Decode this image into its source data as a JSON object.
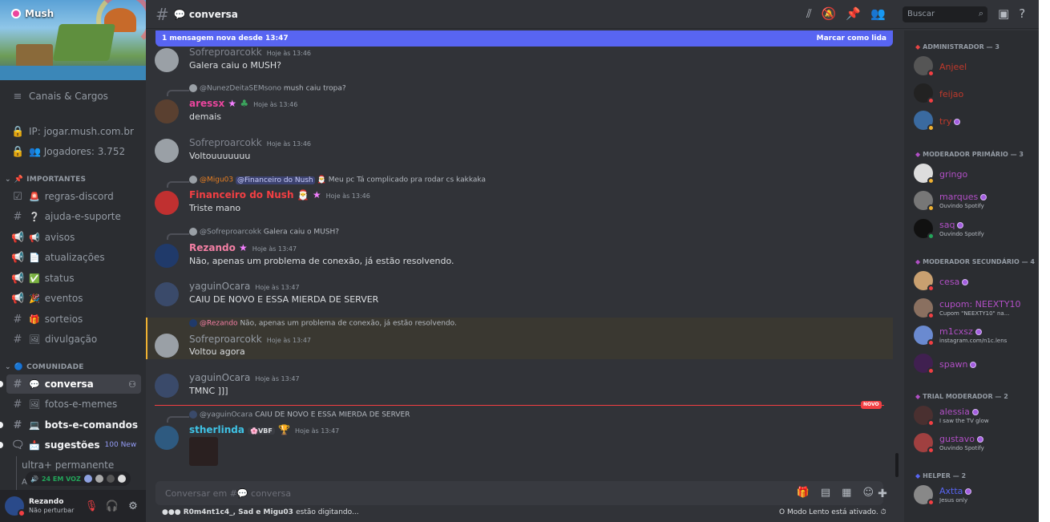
{
  "server": {
    "name": "Mush",
    "items": [
      {
        "label": "Canais & Cargos",
        "icon": "list-icon"
      },
      {
        "label": "IP: jogar.mush.com.br",
        "icon": "lock-icon"
      },
      {
        "label": "👥 Jogadores: 3.752",
        "icon": "lock-icon"
      }
    ],
    "categories": [
      {
        "label": "IMPORTANTES",
        "emoji": "📌"
      },
      {
        "label": "COMUNIDADE",
        "emoji": "🔵"
      }
    ],
    "channels": [
      {
        "label": "regras-discord",
        "emoji": "🚨",
        "icon": "rules-icon"
      },
      {
        "label": "ajuda-e-suporte",
        "emoji": "❔",
        "icon": "hash-icon"
      },
      {
        "label": "avisos",
        "emoji": "📢",
        "icon": "megaphone-icon"
      },
      {
        "label": "atualizações",
        "emoji": "📄",
        "icon": "megaphone-icon"
      },
      {
        "label": "status",
        "emoji": "✅",
        "icon": "megaphone-icon"
      },
      {
        "label": "eventos",
        "emoji": "🎉",
        "icon": "megaphone-icon"
      },
      {
        "label": "sorteios",
        "emoji": "🎁",
        "icon": "hash-icon"
      },
      {
        "label": "divulgação",
        "emoji": "🖼",
        "icon": "hash-icon"
      },
      {
        "label": "conversa",
        "emoji": "💬",
        "icon": "hash-icon"
      },
      {
        "label": "fotos-e-memes",
        "emoji": "🖼",
        "icon": "hash-icon"
      },
      {
        "label": "bots-e-comandos",
        "emoji": "💻",
        "icon": "hash-icon"
      },
      {
        "label": "sugestões",
        "emoji": "📩",
        "icon": "forum-icon",
        "badge": "100 New"
      },
      {
        "label": "ultra+ permanente"
      },
      {
        "label": "Auto-click"
      }
    ],
    "voice_pill": "24 EM VOZ"
  },
  "user": {
    "name": "Rezando",
    "status": "Não perturbar"
  },
  "header": {
    "channel": "💬 conversa",
    "search_placeholder": "Buscar"
  },
  "newbar": {
    "text": "1 mensagem nova desde 13:47",
    "action": "Marcar como lida"
  },
  "messages": [
    {
      "user": "Sofreproarcokk",
      "time": "Hoje às 13:46",
      "text": "Galera caiu o MUSH?"
    },
    {
      "reply_user": "@NunezDeitaSEMsono",
      "reply_text": "mush caiu tropa?",
      "user": "aressx",
      "time": "Hoje às 13:46",
      "text": "demais"
    },
    {
      "user": "Sofreproarcokk",
      "time": "Hoje às 13:46",
      "text": "Voltouuuuuuu"
    },
    {
      "reply_user": "@Migu03",
      "reply_mention": "@Financeiro do Nush",
      "reply_text": "Meu pc Tá complicado pra rodar cs kakkaka",
      "user": "Financeiro do Nush",
      "time": "Hoje às 13:46",
      "text": "Triste mano"
    },
    {
      "reply_user": "@Sofreproarcokk",
      "reply_text": "Galera caiu o MUSH?",
      "user": "Rezando",
      "time": "Hoje às 13:47",
      "text": "Não, apenas um problema de conexão, já estão resolvendo."
    },
    {
      "user": "yaguinOcara",
      "time": "Hoje às 13:47",
      "text": "CAIU DE NOVO E ESSA MIERDA DE SERVER"
    },
    {
      "reply_user": "@Rezando",
      "reply_text": "Não, apenas um problema de conexão, já estão resolvendo.",
      "user": "Sofreproarcokk",
      "time": "Hoje às 13:47",
      "text": "Voltou agora"
    },
    {
      "user": "yaguinOcara",
      "time": "Hoje às 13:47",
      "text": "TMNC ]]]"
    },
    {
      "reply_user": "@yaguinOcara",
      "reply_text": "CAIU DE NOVO E ESSA MIERDA DE SERVER",
      "user": "stherlinda",
      "tag": "VBF",
      "time": "Hoje às 13:47",
      "text": ""
    }
  ],
  "new_tag": "NOVO",
  "composer": {
    "placeholder": "Conversar em #💬 conversa"
  },
  "typing": {
    "names": "R0m4nt1c4_, Sad e Migu03",
    "suffix": "estão digitando..."
  },
  "slowmode": "O Modo Lento está ativado.",
  "member_groups": [
    {
      "label": "ADMINISTRADOR — 3",
      "members": [
        {
          "name": "Anjeel",
          "color": "#c0392b",
          "sub": ""
        },
        {
          "name": "feijao",
          "color": "#c0392b",
          "sub": ""
        },
        {
          "name": "try",
          "color": "#c0392b",
          "sub": ""
        }
      ]
    },
    {
      "label": "MODERADOR PRIMÁRIO — 3",
      "members": [
        {
          "name": "gringo",
          "color": "#b14fc5",
          "sub": ""
        },
        {
          "name": "marques",
          "color": "#b14fc5",
          "sub": "Ouvindo Spotify"
        },
        {
          "name": "saq",
          "color": "#b14fc5",
          "sub": "Ouvindo Spotify"
        }
      ]
    },
    {
      "label": "MODERADOR SECUNDÁRIO — 4",
      "members": [
        {
          "name": "cesa",
          "color": "#b14fc5",
          "sub": ""
        },
        {
          "name": "cupom: NEEXTY10",
          "color": "#b14fc5",
          "sub": "Cupom \"NEEXTY10\" na..."
        },
        {
          "name": "m1cxsz",
          "color": "#b14fc5",
          "sub": "instagram.com/n1c.lens"
        },
        {
          "name": "spawn",
          "color": "#b14fc5",
          "sub": ""
        }
      ]
    },
    {
      "label": "TRIAL MODERADOR — 2",
      "members": [
        {
          "name": "alessia",
          "color": "#b14fc5",
          "sub": "I saw the TV glow"
        },
        {
          "name": "gustavo",
          "color": "#b14fc5",
          "sub": "Ouvindo Spotify"
        }
      ]
    },
    {
      "label": "HELPER — 2",
      "members": [
        {
          "name": "Axtta",
          "color": "#5865f2",
          "sub": "Jesus only"
        }
      ]
    }
  ],
  "colors": {
    "accent": "#5865f2",
    "dnd": "#f23f43",
    "highlight": "#f0b232"
  }
}
